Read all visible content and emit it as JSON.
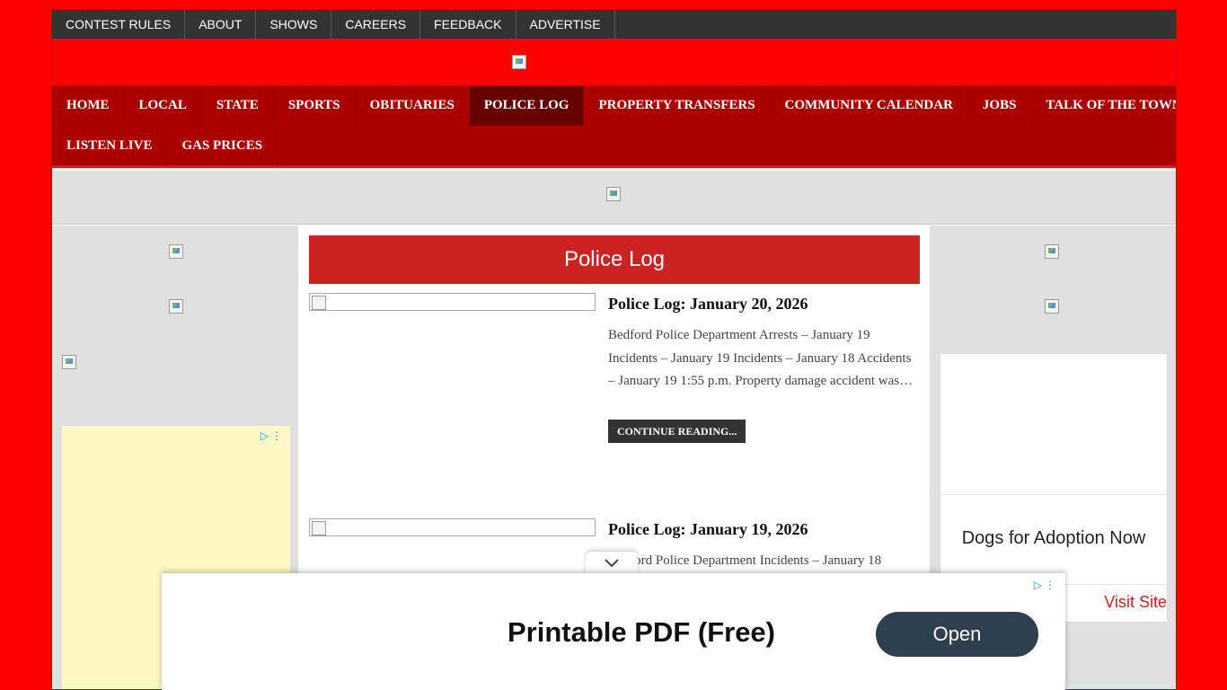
{
  "topbar": {
    "items": [
      "CONTEST RULES",
      "ABOUT",
      "SHOWS",
      "CAREERS",
      "FEEDBACK",
      "ADVERTISE"
    ]
  },
  "mainnav": {
    "row1": [
      "HOME",
      "LOCAL",
      "STATE",
      "SPORTS",
      "OBITUARIES",
      "POLICE LOG",
      "PROPERTY TRANSFERS",
      "COMMUNITY CALENDAR",
      "JOBS",
      "TALK OF THE TOWN"
    ],
    "row2": [
      "LISTEN LIVE",
      "GAS PRICES"
    ],
    "active": "POLICE LOG",
    "icon1": "▯",
    "icon2": "▯"
  },
  "section": {
    "title": "Police Log"
  },
  "posts": [
    {
      "title": "Police Log: January 20, 2026",
      "excerpt": "Bedford Police Department Arrests – January 19 Incidents – January 19 Incidents – January 18 Accidents – January 19 1:55 p.m. Property damage accident was…",
      "more": "CONTINUE READING..."
    },
    {
      "title": "Police Log: January 19, 2026",
      "excerpt": "Bedford Police Department Incidents – January 18",
      "more": ""
    }
  ],
  "right_ad": {
    "headline": "Dogs for Adoption Now",
    "link": "Visit Site"
  },
  "sticky_ad": {
    "headline": "Printable PDF (Free)",
    "button": "Open"
  },
  "colors": {
    "page_bg": "#ff0000",
    "nav_bg": "#aa0000",
    "nav_active": "#660000",
    "section_title_bg": "#cc2222",
    "topbar_bg": "#333333"
  }
}
